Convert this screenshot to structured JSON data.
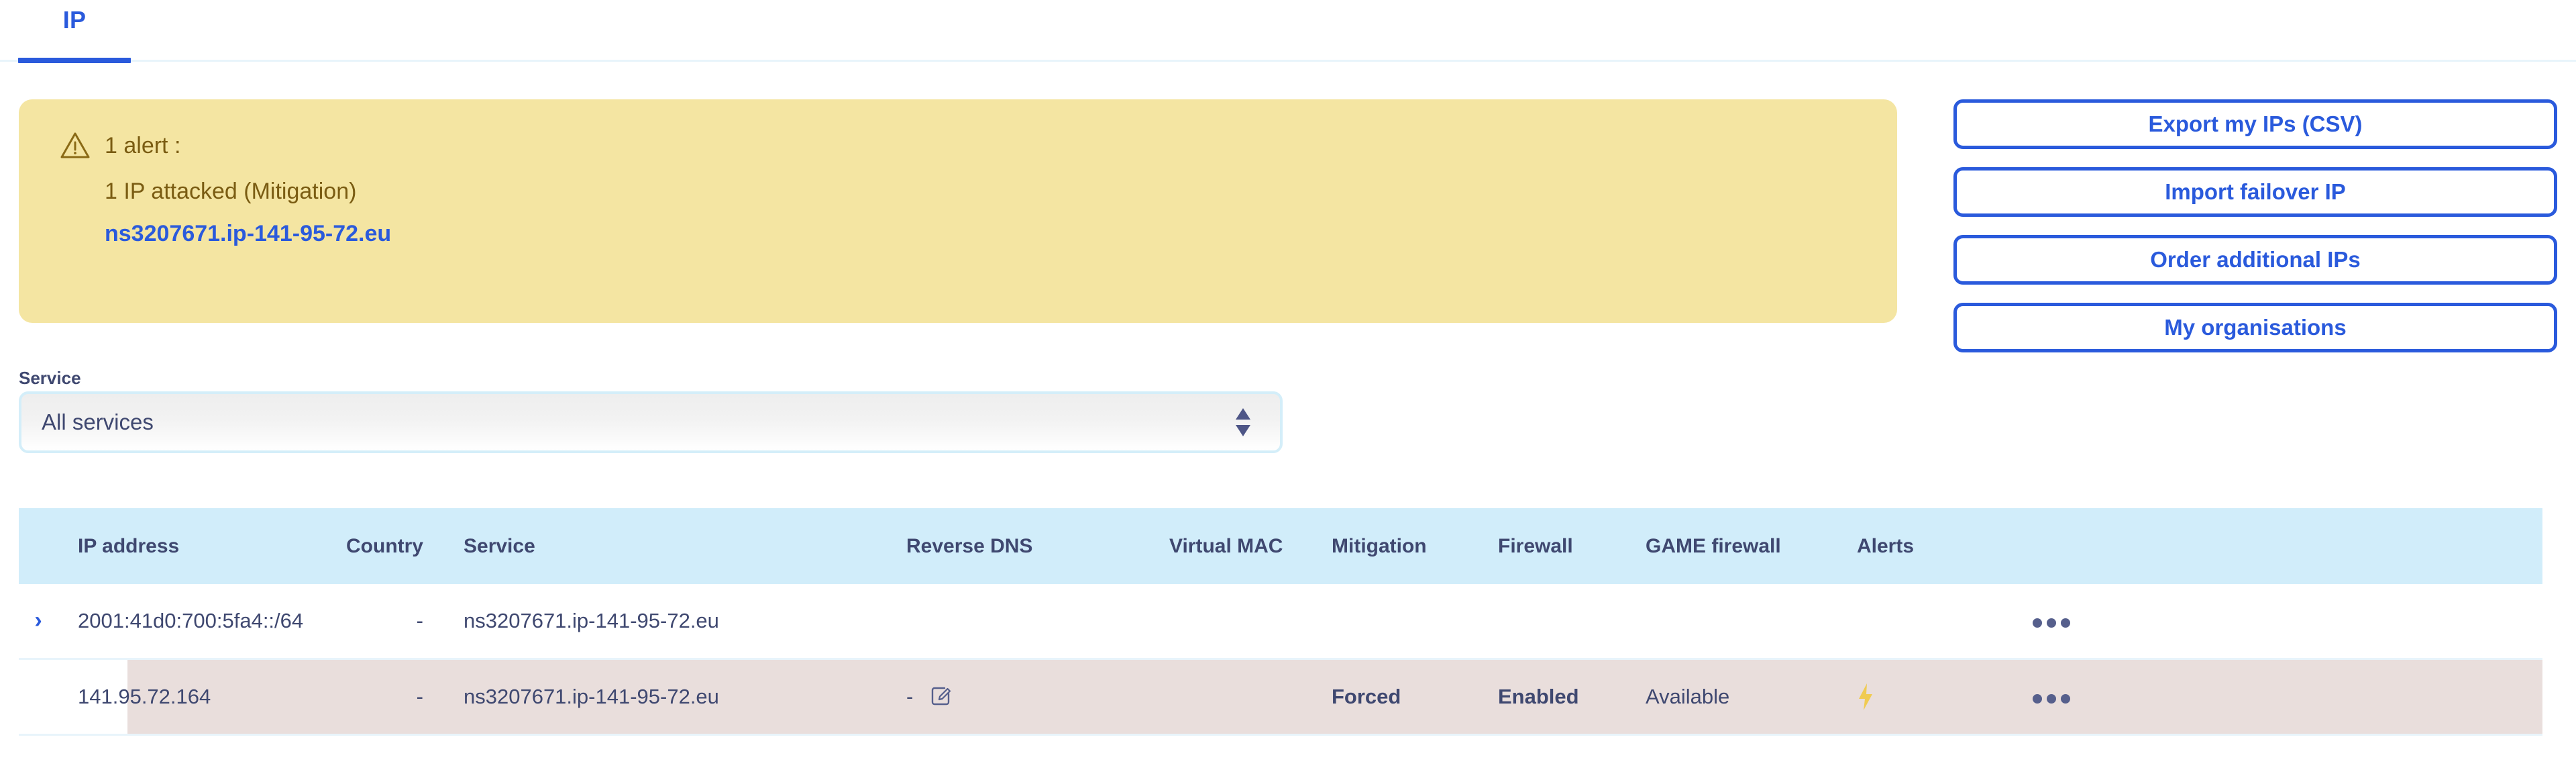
{
  "tabs": [
    {
      "label": "IP",
      "active": true
    }
  ],
  "alert": {
    "icon": "warning-triangle-icon",
    "title": "1 alert :",
    "detail": "1 IP attacked (Mitigation)",
    "link": "ns3207671.ip-141-95-72.eu",
    "background_color": "#f4e5a2",
    "text_color": "#7a5c12",
    "link_color": "#2a5adc"
  },
  "actions": {
    "buttons": [
      {
        "label": "Export my IPs (CSV)",
        "name": "export-my-ips-csv-button"
      },
      {
        "label": "Import failover IP",
        "name": "import-failover-ip-button"
      },
      {
        "label": "Order additional IPs",
        "name": "order-additional-ips-button"
      },
      {
        "label": "My organisations",
        "name": "my-organisations-button"
      }
    ],
    "accent_color": "#2a5adc"
  },
  "filter": {
    "label": "Service",
    "selected": "All services",
    "options": [
      "All services"
    ]
  },
  "table": {
    "columns": [
      "IP address",
      "Country",
      "Service",
      "Reverse DNS",
      "Virtual MAC",
      "Mitigation",
      "Firewall",
      "GAME firewall",
      "Alerts"
    ],
    "header_background": "#d1edfa",
    "attacked_row_background": "#e9dedc",
    "rows": [
      {
        "expandable": true,
        "expand_icon": "chevron-right-icon",
        "ip_address": "2001:41d0:700:5fa4::/64",
        "country": "-",
        "service": "ns3207671.ip-141-95-72.eu",
        "reverse_dns": "",
        "virtual_mac": "",
        "mitigation": "",
        "firewall": "",
        "game_firewall": "",
        "alerts": "",
        "menu_icon": "kebab-menu-icon",
        "attacked": false
      },
      {
        "expandable": false,
        "expand_icon": "",
        "ip_address": "141.95.72.164",
        "country": "-",
        "service": "ns3207671.ip-141-95-72.eu",
        "reverse_dns": "-",
        "reverse_dns_edit_icon": "edit-pencil-icon",
        "virtual_mac": "",
        "mitigation": "Forced",
        "firewall": "Enabled",
        "game_firewall": "Available",
        "alerts": "lightning-bolt-icon",
        "menu_icon": "kebab-menu-icon",
        "attacked": true
      }
    ]
  }
}
